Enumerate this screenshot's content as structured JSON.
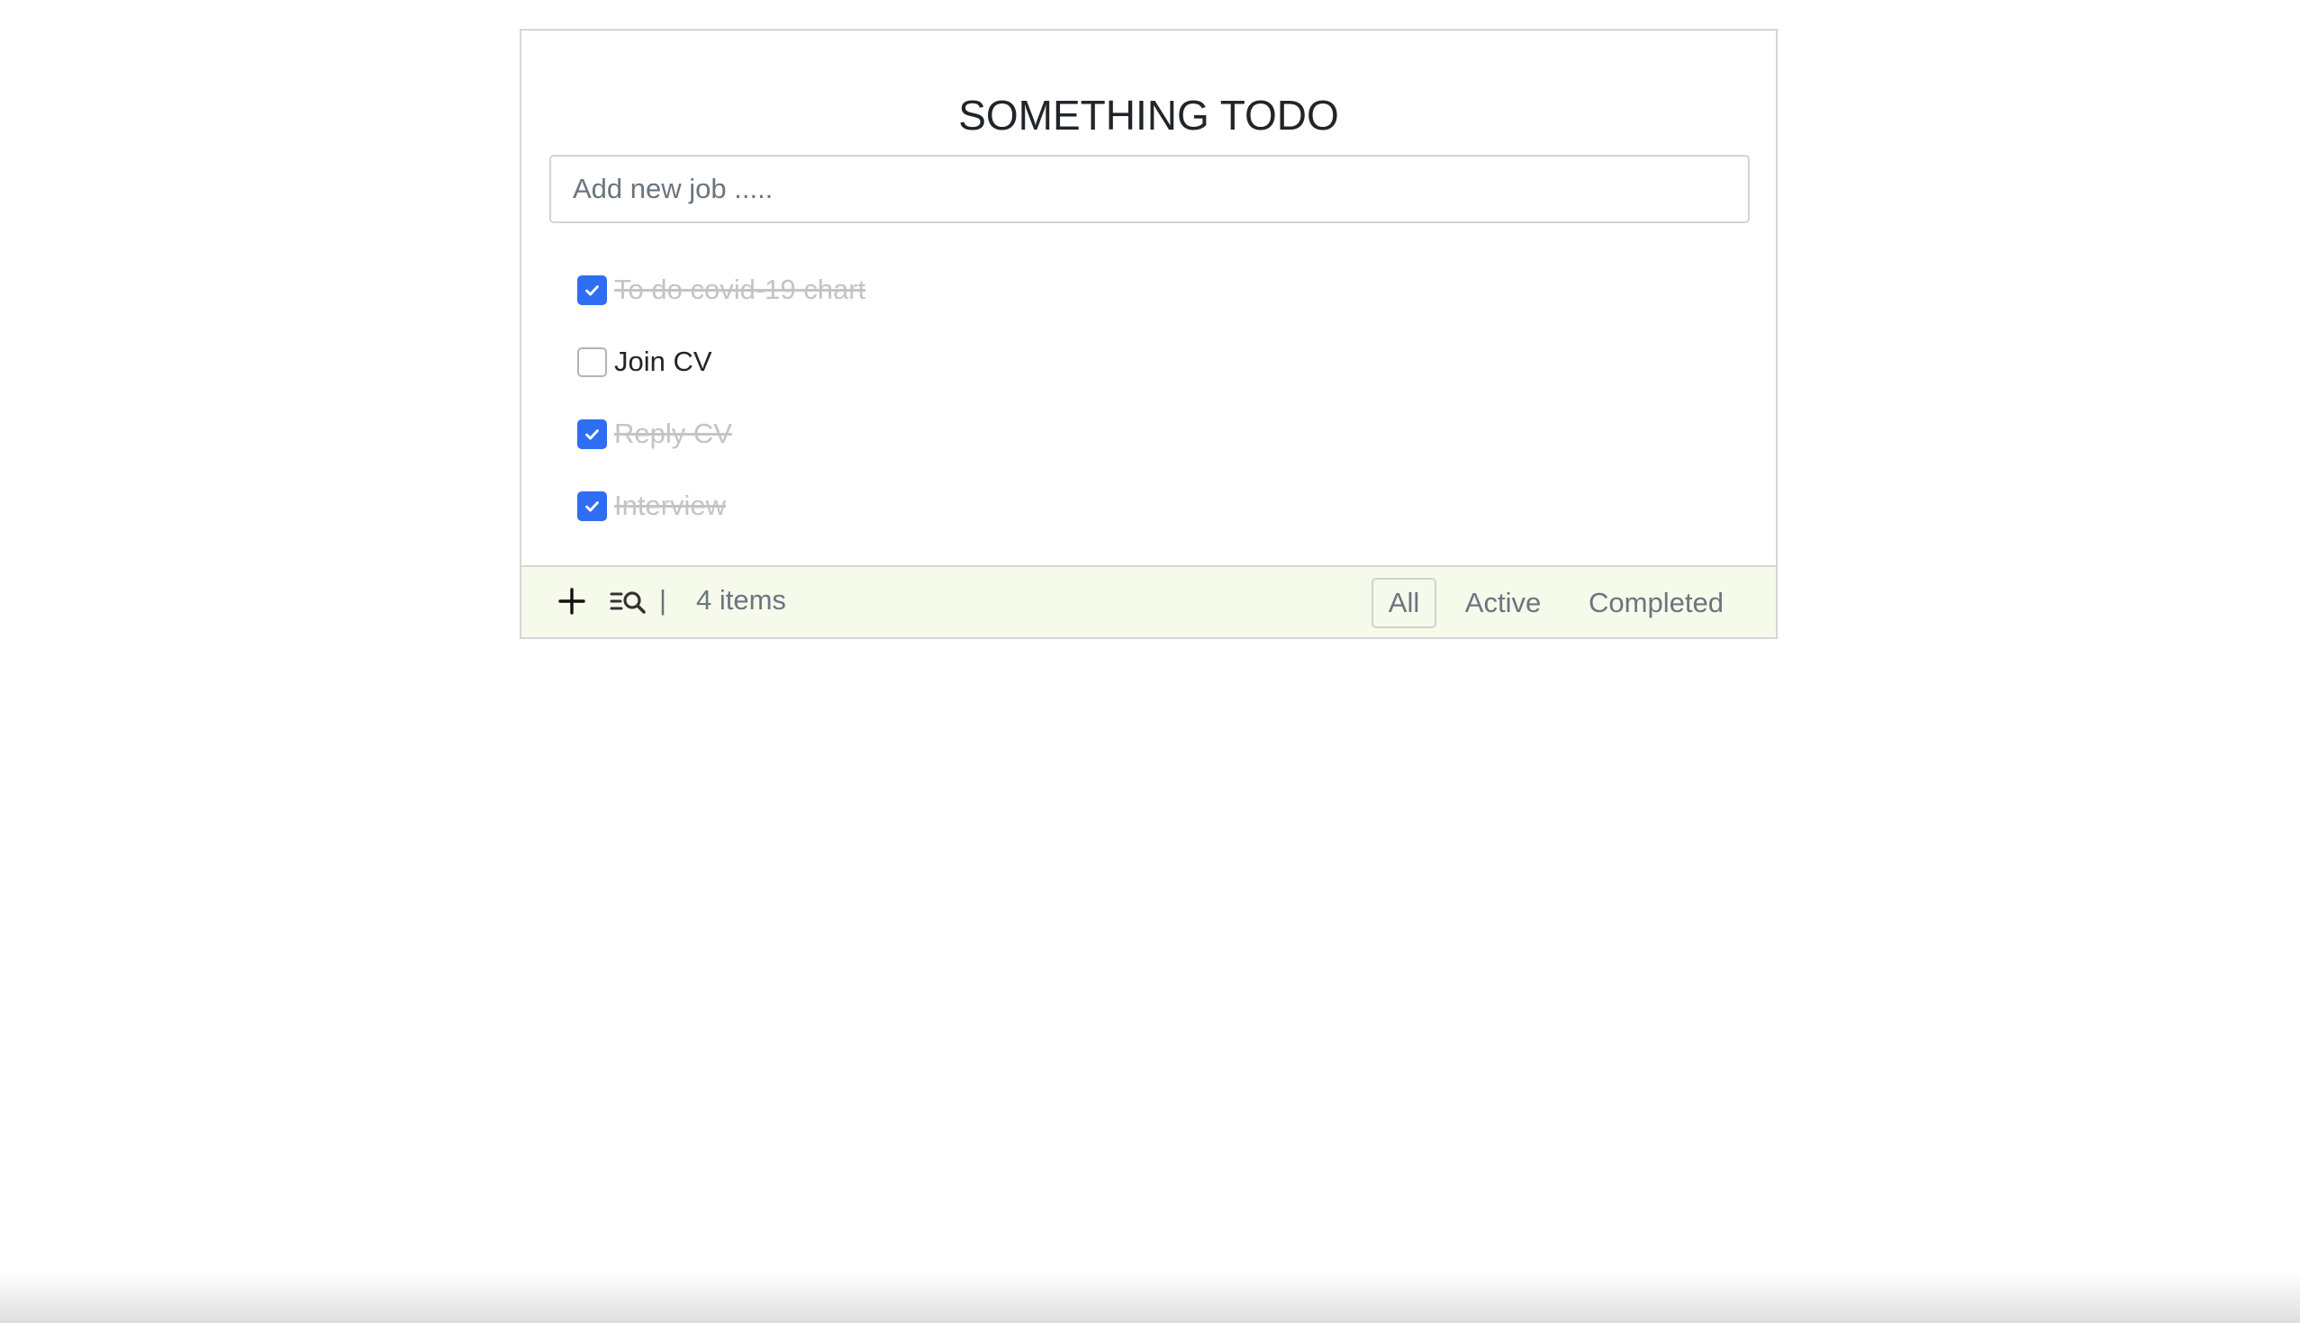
{
  "app": {
    "title": "SOMETHING TODO"
  },
  "new_job": {
    "placeholder": "Add new job .....",
    "value": ""
  },
  "todos": [
    {
      "text": "To do covid-19 chart",
      "completed": true
    },
    {
      "text": "Join CV",
      "completed": false
    },
    {
      "text": "Reply CV",
      "completed": true
    },
    {
      "text": "Interview",
      "completed": true
    }
  ],
  "footer": {
    "separator": "|",
    "count_label": "4 items",
    "filters": [
      "All",
      "Active",
      "Completed"
    ],
    "selected_filter": "All",
    "add_icon": "plus-icon",
    "search_icon": "search-list-icon"
  },
  "colors": {
    "accent": "#2f6ef2",
    "footer_bg": "#f5faeb",
    "completed_text": "#c4c4c4"
  }
}
